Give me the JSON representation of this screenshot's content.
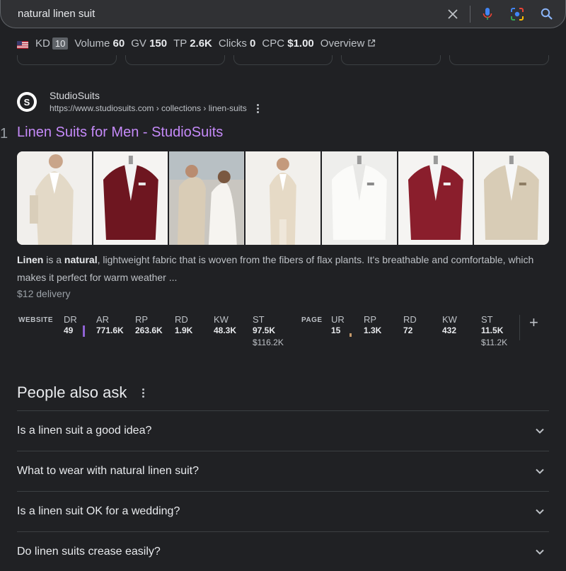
{
  "search": {
    "query": "natural linen suit"
  },
  "metrics_bar": {
    "kd_label": "KD",
    "kd_value": "10",
    "volume_label": "Volume",
    "volume_value": "60",
    "gv_label": "GV",
    "gv_value": "150",
    "tp_label": "TP",
    "tp_value": "2.6K",
    "clicks_label": "Clicks",
    "clicks_value": "0",
    "cpc_label": "CPC",
    "cpc_value": "$1.00",
    "overview_label": "Overview"
  },
  "result": {
    "rank": "1",
    "site_name": "StudioSuits",
    "favicon_letter": "S",
    "url": "https://www.studiosuits.com › collections › linen-suits",
    "title": "Linen Suits for Men - StudioSuits",
    "snippet_bold_1": "Linen",
    "snippet_text_1": " is a ",
    "snippet_bold_2": "natural",
    "snippet_text_2": ", lightweight fabric that is woven from the fibers of flax plants. It's breathable and comfortable, which makes it perfect for warm weather ...",
    "delivery": "$12 delivery",
    "thumbnails": [
      {
        "name": "beige-suit-man",
        "color": "#e6dccb"
      },
      {
        "name": "burgundy-jacket",
        "color": "#7a1c26"
      },
      {
        "name": "wedding-couple",
        "color": "#d8cdbc"
      },
      {
        "name": "ivory-suit-full",
        "color": "#e9dfcf"
      },
      {
        "name": "white-jacket",
        "color": "#f3f2ee"
      },
      {
        "name": "red-jacket",
        "color": "#8b1f2d"
      },
      {
        "name": "tan-jacket",
        "color": "#dcd1bd"
      }
    ]
  },
  "serp_metrics": {
    "website_label": "WEBSITE",
    "page_label": "PAGE",
    "website": {
      "dr_label": "DR",
      "dr_value": "49",
      "ar_label": "AR",
      "ar_value": "771.6K",
      "rp_label": "RP",
      "rp_value": "263.6K",
      "rd_label": "RD",
      "rd_value": "1.9K",
      "kw_label": "KW",
      "kw_value": "48.3K",
      "st_label": "ST",
      "st_value": "97.5K",
      "st_sub": "$116.2K"
    },
    "page": {
      "ur_label": "UR",
      "ur_value": "15",
      "rp_label": "RP",
      "rp_value": "1.3K",
      "rd_label": "RD",
      "rd_value": "72",
      "kw_label": "KW",
      "kw_value": "432",
      "st_label": "ST",
      "st_value": "11.5K",
      "st_sub": "$11.2K"
    },
    "add_label": "+"
  },
  "people_also_ask": {
    "title": "People also ask",
    "questions": [
      "Is a linen suit a good idea?",
      "What to wear with natural linen suit?",
      "Is a linen suit OK for a wedding?",
      "Do linen suits crease easily?"
    ]
  },
  "colors": {
    "background": "#202124",
    "link_visited": "#c58af9",
    "dr_bar": "#8f63d4"
  }
}
